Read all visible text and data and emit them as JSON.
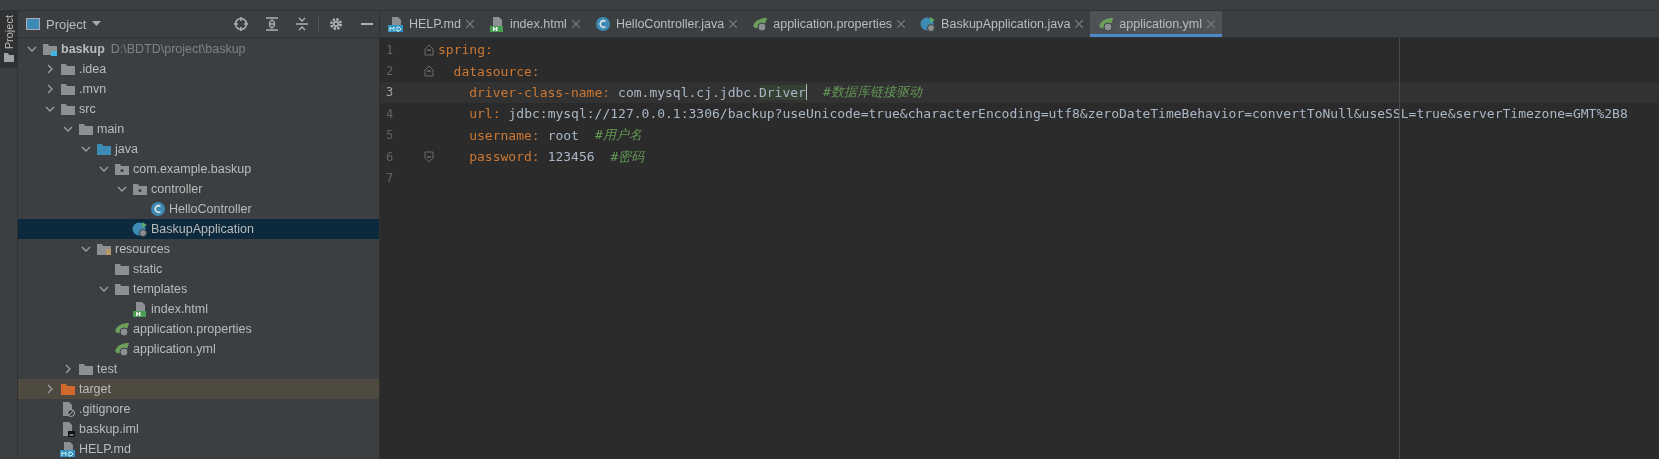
{
  "tool_strip": {
    "label": "Project"
  },
  "sidebar": {
    "title": "Project",
    "tree": [
      {
        "label": "baskup",
        "path": "D:\\BDTD\\project\\baskup",
        "kind": "module",
        "expanded": true,
        "selected": false,
        "children": [
          {
            "label": ".idea",
            "kind": "folder",
            "expanded": false,
            "selected": false
          },
          {
            "label": ".mvn",
            "kind": "folder",
            "expanded": false,
            "selected": false
          },
          {
            "label": "src",
            "kind": "folder",
            "expanded": true,
            "selected": false,
            "children": [
              {
                "label": "main",
                "kind": "folder",
                "expanded": true,
                "selected": false,
                "children": [
                  {
                    "label": "java",
                    "kind": "source",
                    "expanded": true,
                    "selected": false,
                    "children": [
                      {
                        "label": "com.example.baskup",
                        "kind": "package",
                        "expanded": true,
                        "selected": false,
                        "children": [
                          {
                            "label": "controller",
                            "kind": "package",
                            "expanded": true,
                            "selected": false,
                            "children": [
                              {
                                "label": "HelloController",
                                "kind": "class",
                                "selected": false
                              }
                            ]
                          },
                          {
                            "label": "BaskupApplication",
                            "kind": "boot",
                            "selected": true
                          }
                        ]
                      }
                    ]
                  },
                  {
                    "label": "resources",
                    "kind": "resources",
                    "expanded": true,
                    "selected": false,
                    "children": [
                      {
                        "label": "static",
                        "kind": "folder",
                        "selected": false
                      },
                      {
                        "label": "templates",
                        "kind": "folder",
                        "expanded": true,
                        "selected": false,
                        "children": [
                          {
                            "label": "index.html",
                            "kind": "html",
                            "selected": false
                          }
                        ]
                      },
                      {
                        "label": "application.properties",
                        "kind": "config",
                        "selected": false
                      },
                      {
                        "label": "application.yml",
                        "kind": "config",
                        "selected": false
                      }
                    ]
                  }
                ]
              },
              {
                "label": "test",
                "kind": "folder",
                "expanded": false,
                "selected": false
              }
            ]
          },
          {
            "label": "target",
            "kind": "excluded",
            "expanded": false,
            "selected": false
          },
          {
            "label": ".gitignore",
            "kind": "ignore",
            "selected": false
          },
          {
            "label": "baskup.iml",
            "kind": "iml",
            "selected": false
          },
          {
            "label": "HELP.md",
            "kind": "md",
            "selected": false
          }
        ]
      }
    ]
  },
  "tabs": [
    {
      "label": "HELP.md",
      "kind": "md",
      "selected": false
    },
    {
      "label": "index.html",
      "kind": "html",
      "selected": false
    },
    {
      "label": "HelloController.java",
      "kind": "class",
      "selected": false
    },
    {
      "label": "application.properties",
      "kind": "config",
      "selected": false
    },
    {
      "label": "BaskupApplication.java",
      "kind": "boot",
      "selected": false
    },
    {
      "label": "application.yml",
      "kind": "config",
      "selected": true
    }
  ],
  "editor": {
    "line_numbers": [
      "1",
      "2",
      "3",
      "4",
      "5",
      "6",
      "7"
    ],
    "yaml": [
      {
        "key": "spring:",
        "current": false,
        "children": [
          {
            "key": "datasource:",
            "current": false,
            "children": [
              {
                "key": "driver-class-name:",
                "value": "com.mysql.cj.jdbc.",
                "value_highlight": "Driver",
                "comment": "#数据库链接驱动",
                "current": true
              },
              {
                "key": "url:",
                "value": "jdbc:mysql://127.0.0.1:3306/backup?useUnicode=true&characterEncoding=utf8&zeroDateTimeBehavior=convertToNull&useSSL=true&serverTimezone=GMT%2B8",
                "current": false
              },
              {
                "key": "username:",
                "value": "root",
                "comment": "#用户名",
                "current": false
              },
              {
                "key": "password:",
                "value": "123456",
                "comment": "#密码",
                "current": false
              }
            ]
          }
        ]
      }
    ]
  }
}
